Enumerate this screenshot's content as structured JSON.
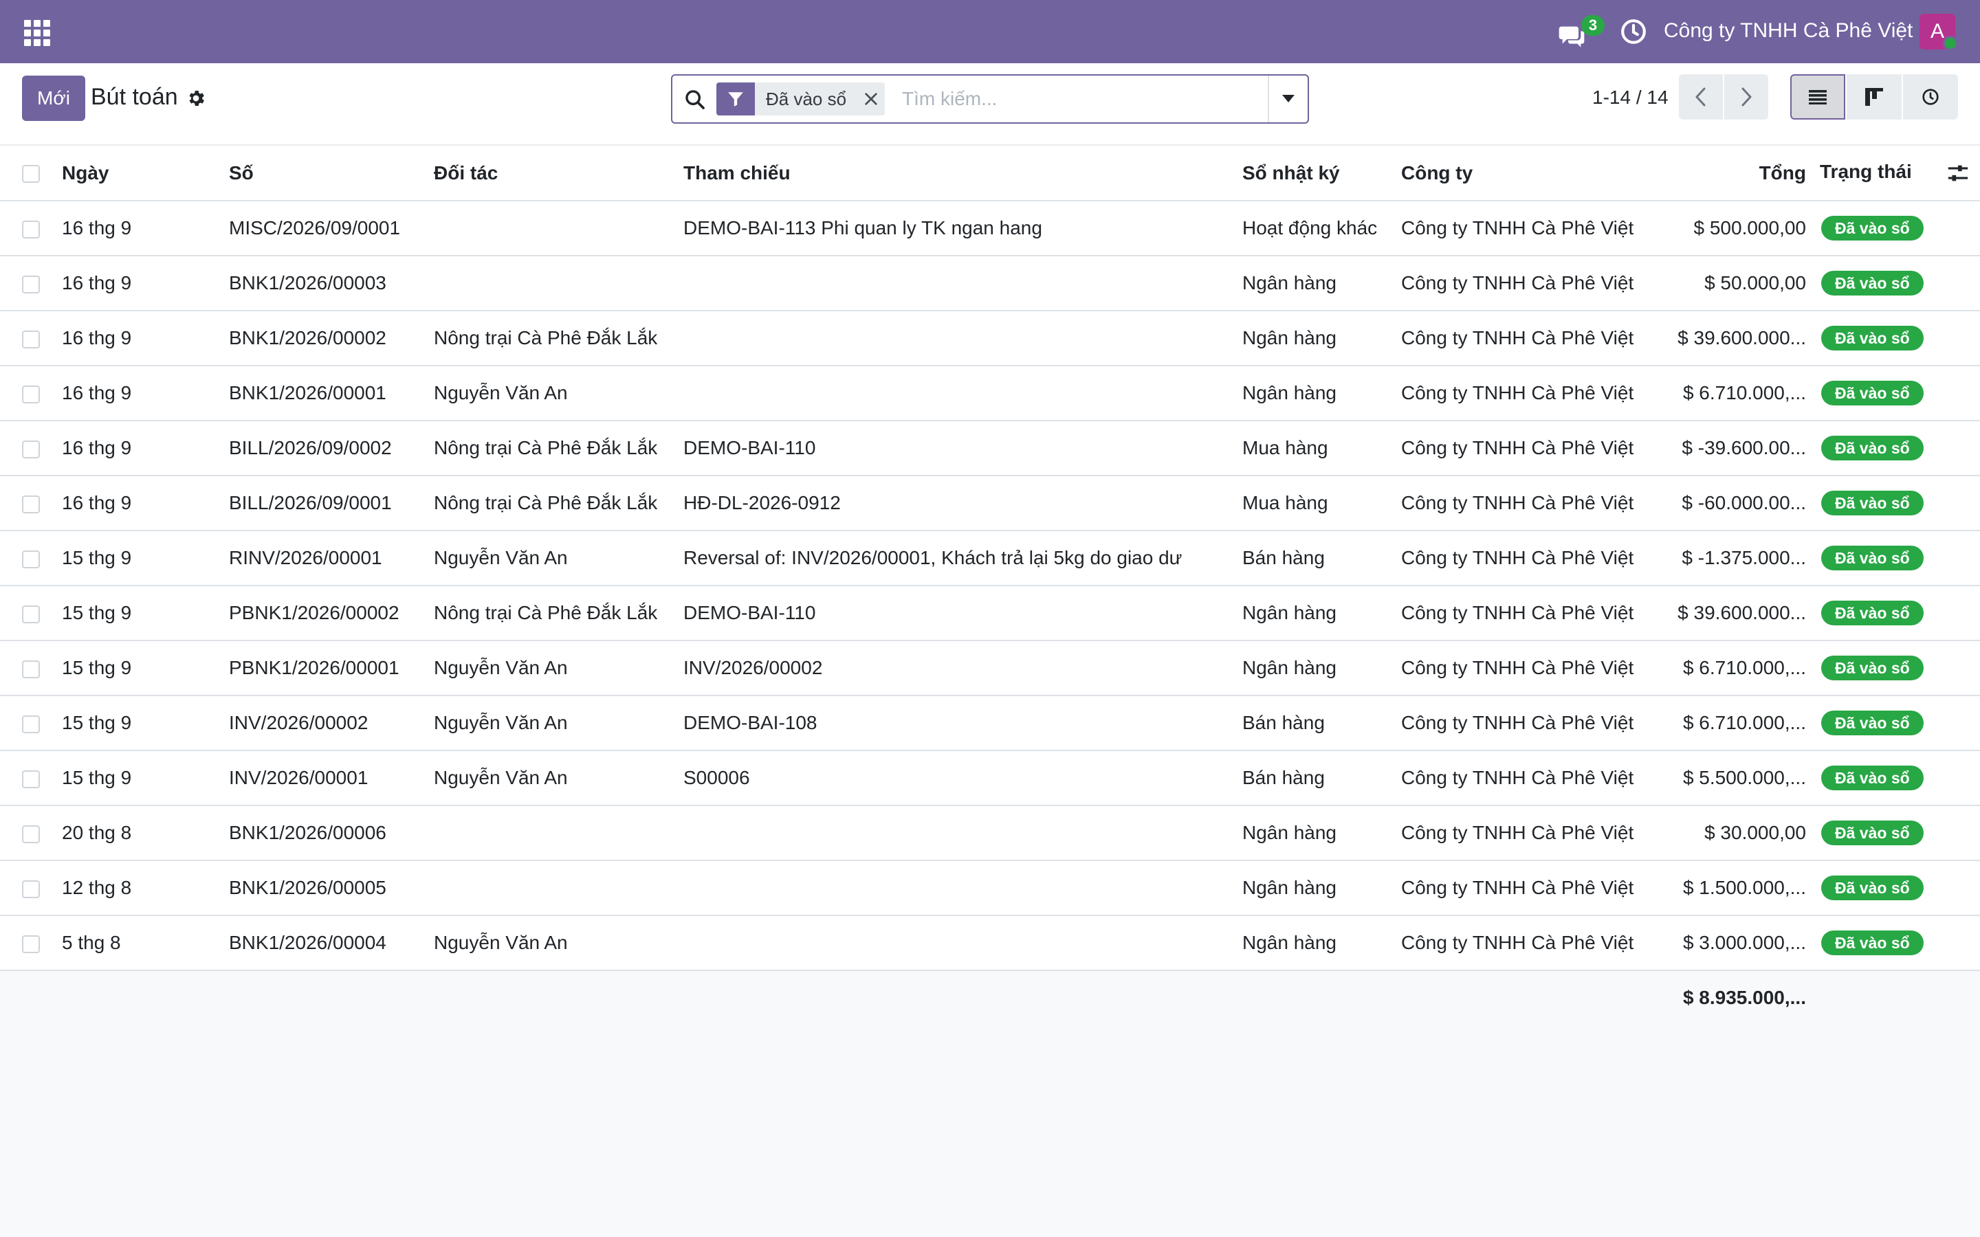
{
  "navbar": {
    "chat_count": "3",
    "company": "Công ty TNHH Cà Phê Việt",
    "avatar_letter": "A",
    "colors": {
      "navbar": "#71639e",
      "badge": "#28a745",
      "avatar": "#b5338f"
    }
  },
  "control": {
    "new_label": "Mới",
    "title": "Bút toán",
    "facet_label": "Đã vào sổ",
    "search_placeholder": "Tìm kiếm...",
    "pager": "1-14 / 14"
  },
  "table": {
    "headers": {
      "date": "Ngày",
      "number": "Số",
      "partner": "Đối tác",
      "ref": "Tham chiếu",
      "journal": "Sổ nhật ký",
      "company": "Công ty",
      "total": "Tổng",
      "status": "Trạng thái"
    },
    "rows": [
      {
        "date": "16 thg 9",
        "number": "MISC/2026/09/0001",
        "partner": "",
        "ref": "DEMO-BAI-113 Phi quan ly TK ngan hang",
        "journal": "Hoạt động khác",
        "company": "Công ty TNHH Cà Phê Việt",
        "total": "$ 500.000,00",
        "status": "Đã vào sổ"
      },
      {
        "date": "16 thg 9",
        "number": "BNK1/2026/00003",
        "partner": "",
        "ref": "",
        "journal": "Ngân hàng",
        "company": "Công ty TNHH Cà Phê Việt",
        "total": "$ 50.000,00",
        "status": "Đã vào sổ"
      },
      {
        "date": "16 thg 9",
        "number": "BNK1/2026/00002",
        "partner": "Nông trại Cà Phê Đắk Lắk",
        "ref": "",
        "journal": "Ngân hàng",
        "company": "Công ty TNHH Cà Phê Việt",
        "total": "$ 39.600.000...",
        "status": "Đã vào sổ"
      },
      {
        "date": "16 thg 9",
        "number": "BNK1/2026/00001",
        "partner": "Nguyễn Văn An",
        "ref": "",
        "journal": "Ngân hàng",
        "company": "Công ty TNHH Cà Phê Việt",
        "total": "$ 6.710.000,...",
        "status": "Đã vào sổ"
      },
      {
        "date": "16 thg 9",
        "number": "BILL/2026/09/0002",
        "partner": "Nông trại Cà Phê Đắk Lắk",
        "ref": "DEMO-BAI-110",
        "journal": "Mua hàng",
        "company": "Công ty TNHH Cà Phê Việt",
        "total": "$ -39.600.00...",
        "status": "Đã vào sổ"
      },
      {
        "date": "16 thg 9",
        "number": "BILL/2026/09/0001",
        "partner": "Nông trại Cà Phê Đắk Lắk",
        "ref": "HĐ-DL-2026-0912",
        "journal": "Mua hàng",
        "company": "Công ty TNHH Cà Phê Việt",
        "total": "$ -60.000.00...",
        "status": "Đã vào sổ"
      },
      {
        "date": "15 thg 9",
        "number": "RINV/2026/00001",
        "partner": "Nguyễn Văn An",
        "ref": "Reversal of: INV/2026/00001, Khách trả lại 5kg do giao dư",
        "journal": "Bán hàng",
        "company": "Công ty TNHH Cà Phê Việt",
        "total": "$ -1.375.000...",
        "status": "Đã vào sổ"
      },
      {
        "date": "15 thg 9",
        "number": "PBNK1/2026/00002",
        "partner": "Nông trại Cà Phê Đắk Lắk",
        "ref": "DEMO-BAI-110",
        "journal": "Ngân hàng",
        "company": "Công ty TNHH Cà Phê Việt",
        "total": "$ 39.600.000...",
        "status": "Đã vào sổ"
      },
      {
        "date": "15 thg 9",
        "number": "PBNK1/2026/00001",
        "partner": "Nguyễn Văn An",
        "ref": "INV/2026/00002",
        "journal": "Ngân hàng",
        "company": "Công ty TNHH Cà Phê Việt",
        "total": "$ 6.710.000,...",
        "status": "Đã vào sổ"
      },
      {
        "date": "15 thg 9",
        "number": "INV/2026/00002",
        "partner": "Nguyễn Văn An",
        "ref": "DEMO-BAI-108",
        "journal": "Bán hàng",
        "company": "Công ty TNHH Cà Phê Việt",
        "total": "$ 6.710.000,...",
        "status": "Đã vào sổ"
      },
      {
        "date": "15 thg 9",
        "number": "INV/2026/00001",
        "partner": "Nguyễn Văn An",
        "ref": "S00006",
        "journal": "Bán hàng",
        "company": "Công ty TNHH Cà Phê Việt",
        "total": "$ 5.500.000,...",
        "status": "Đã vào sổ"
      },
      {
        "date": "20 thg 8",
        "number": "BNK1/2026/00006",
        "partner": "",
        "ref": "",
        "journal": "Ngân hàng",
        "company": "Công ty TNHH Cà Phê Việt",
        "total": "$ 30.000,00",
        "status": "Đã vào sổ"
      },
      {
        "date": "12 thg 8",
        "number": "BNK1/2026/00005",
        "partner": "",
        "ref": "",
        "journal": "Ngân hàng",
        "company": "Công ty TNHH Cà Phê Việt",
        "total": "$ 1.500.000,...",
        "status": "Đã vào sổ"
      },
      {
        "date": "5 thg 8",
        "number": "BNK1/2026/00004",
        "partner": "Nguyễn Văn An",
        "ref": "",
        "journal": "Ngân hàng",
        "company": "Công ty TNHH Cà Phê Việt",
        "total": "$ 3.000.000,...",
        "status": "Đã vào sổ"
      }
    ],
    "footer_total": "$ 8.935.000,..."
  }
}
